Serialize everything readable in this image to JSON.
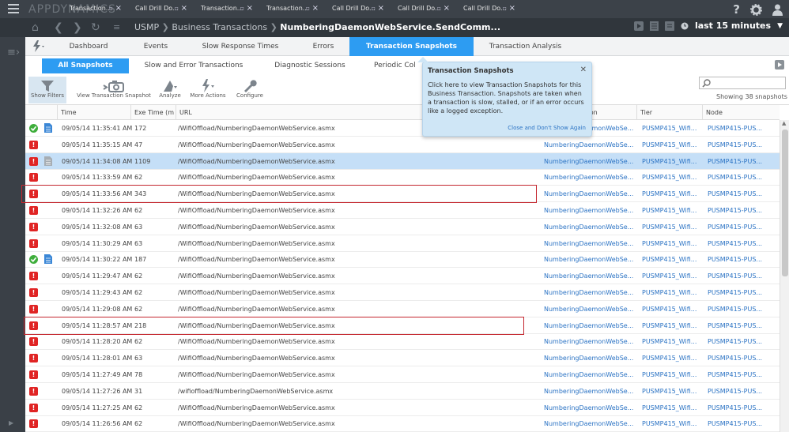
{
  "top_bar": {
    "logo": "APPDYNAMICS",
    "tabs": [
      {
        "label": "Transaction..."
      },
      {
        "label": "Call Drill Do..."
      },
      {
        "label": "Transaction..."
      },
      {
        "label": "Transaction..."
      },
      {
        "label": "Call Drill Do..."
      },
      {
        "label": "Call Drill Do..."
      },
      {
        "label": "Call Drill Do..."
      }
    ],
    "right_icons": [
      "help-icon",
      "gear-icon",
      "user-icon"
    ]
  },
  "nav_bar": {
    "breadcrumb": [
      "USMP",
      "Business Transactions",
      "NumberingDaemonWebService.SendComm..."
    ],
    "time_range": "last 15 minutes"
  },
  "main_tabs": [
    {
      "label": "Dashboard",
      "active": false
    },
    {
      "label": "Events",
      "active": false
    },
    {
      "label": "Slow Response Times",
      "active": false
    },
    {
      "label": "Errors",
      "active": false
    },
    {
      "label": "Transaction Snapshots",
      "active": true
    },
    {
      "label": "Transaction Analysis",
      "active": false
    }
  ],
  "sub_tabs": [
    {
      "label": "All Snapshots",
      "active": true
    },
    {
      "label": "Slow and Error Transactions",
      "active": false
    },
    {
      "label": "Diagnostic Sessions",
      "active": false
    },
    {
      "label": "Periodic Col",
      "active": false
    }
  ],
  "toolbar": {
    "show_filters": "Show Filters",
    "view_snapshot": "View Transaction Snapshot",
    "analyze": "Analyze",
    "more_actions": "More Actions",
    "configure": "Configure",
    "search_placeholder": "",
    "showing": "Showing 38 snapshots"
  },
  "table": {
    "columns": [
      "Time",
      "Exe Time (m",
      "URL",
      "ction",
      "Tier",
      "Node"
    ],
    "rows": [
      {
        "status": "normal",
        "doc": "blue",
        "time": "09/05/14 11:35:41 AM",
        "exe": "172",
        "url": "/WifiOffload/NumberingDaemonWebService.asmx",
        "bt": "NumberingDaemonWebSe...",
        "tier": "PUSMP415_Wifi...",
        "node": "PUSMP415-PUS..."
      },
      {
        "status": "error",
        "doc": "",
        "time": "09/05/14 11:35:15 AM",
        "exe": "47",
        "url": "/WifiOffload/NumberingDaemonWebService.asmx",
        "bt": "NumberingDaemonWebSe...",
        "tier": "PUSMP415_Wifi...",
        "node": "PUSMP415-PUS..."
      },
      {
        "status": "error",
        "doc": "gray",
        "time": "09/05/14 11:34:08 AM",
        "exe": "1109",
        "url": "/WifiOffload/NumberingDaemonWebService.asmx",
        "bt": "NumberingDaemonWebSe...",
        "tier": "PUSMP415_Wifi...",
        "node": "PUSMP415-PUS...",
        "selected": true
      },
      {
        "status": "error",
        "doc": "",
        "time": "09/05/14 11:33:59 AM",
        "exe": "62",
        "url": "/WifiOffload/NumberingDaemonWebService.asmx",
        "bt": "NumberingDaemonWebSe...",
        "tier": "PUSMP415_Wifi...",
        "node": "PUSMP415-PUS..."
      },
      {
        "status": "error",
        "doc": "",
        "time": "09/05/14 11:33:56 AM",
        "exe": "343",
        "url": "/WifiOffload/NumberingDaemonWebService.asmx",
        "bt": "NumberingDaemonWebSe...",
        "tier": "PUSMP415_Wifi...",
        "node": "PUSMP415-PUS...",
        "highlighted": true
      },
      {
        "status": "error",
        "doc": "",
        "time": "09/05/14 11:32:26 AM",
        "exe": "62",
        "url": "/WifiOffload/NumberingDaemonWebService.asmx",
        "bt": "NumberingDaemonWebSe...",
        "tier": "PUSMP415_Wifi...",
        "node": "PUSMP415-PUS..."
      },
      {
        "status": "error",
        "doc": "",
        "time": "09/05/14 11:32:08 AM",
        "exe": "63",
        "url": "/WifiOffload/NumberingDaemonWebService.asmx",
        "bt": "NumberingDaemonWebSe...",
        "tier": "PUSMP415_Wifi...",
        "node": "PUSMP415-PUS..."
      },
      {
        "status": "error",
        "doc": "",
        "time": "09/05/14 11:30:29 AM",
        "exe": "63",
        "url": "/WifiOffload/NumberingDaemonWebService.asmx",
        "bt": "NumberingDaemonWebSe...",
        "tier": "PUSMP415_Wifi...",
        "node": "PUSMP415-PUS..."
      },
      {
        "status": "normal",
        "doc": "blue",
        "time": "09/05/14 11:30:22 AM",
        "exe": "187",
        "url": "/WifiOffload/NumberingDaemonWebService.asmx",
        "bt": "NumberingDaemonWebSe...",
        "tier": "PUSMP415_Wifi...",
        "node": "PUSMP415-PUS..."
      },
      {
        "status": "error",
        "doc": "",
        "time": "09/05/14 11:29:47 AM",
        "exe": "62",
        "url": "/WifiOffload/NumberingDaemonWebService.asmx",
        "bt": "NumberingDaemonWebSe...",
        "tier": "PUSMP415_Wifi...",
        "node": "PUSMP415-PUS..."
      },
      {
        "status": "error",
        "doc": "",
        "time": "09/05/14 11:29:43 AM",
        "exe": "62",
        "url": "/WifiOffload/NumberingDaemonWebService.asmx",
        "bt": "NumberingDaemonWebSe...",
        "tier": "PUSMP415_Wifi...",
        "node": "PUSMP415-PUS..."
      },
      {
        "status": "error",
        "doc": "",
        "time": "09/05/14 11:29:08 AM",
        "exe": "62",
        "url": "/WifiOffload/NumberingDaemonWebService.asmx",
        "bt": "NumberingDaemonWebSe...",
        "tier": "PUSMP415_Wifi...",
        "node": "PUSMP415-PUS..."
      },
      {
        "status": "error",
        "doc": "",
        "time": "09/05/14 11:28:57 AM",
        "exe": "218",
        "url": "/WifiOffload/NumberingDaemonWebService.asmx",
        "bt": "NumberingDaemonWebSe...",
        "tier": "PUSMP415_Wifi...",
        "node": "PUSMP415-PUS...",
        "highlighted": true
      },
      {
        "status": "error",
        "doc": "",
        "time": "09/05/14 11:28:20 AM",
        "exe": "62",
        "url": "/WifiOffload/NumberingDaemonWebService.asmx",
        "bt": "NumberingDaemonWebSe...",
        "tier": "PUSMP415_Wifi...",
        "node": "PUSMP415-PUS..."
      },
      {
        "status": "error",
        "doc": "",
        "time": "09/05/14 11:28:01 AM",
        "exe": "63",
        "url": "/WifiOffload/NumberingDaemonWebService.asmx",
        "bt": "NumberingDaemonWebSe...",
        "tier": "PUSMP415_Wifi...",
        "node": "PUSMP415-PUS..."
      },
      {
        "status": "error",
        "doc": "",
        "time": "09/05/14 11:27:49 AM",
        "exe": "78",
        "url": "/WifiOffload/NumberingDaemonWebService.asmx",
        "bt": "NumberingDaemonWebSe...",
        "tier": "PUSMP415_Wifi...",
        "node": "PUSMP415-PUS..."
      },
      {
        "status": "error",
        "doc": "",
        "time": "09/05/14 11:27:26 AM",
        "exe": "31",
        "url": "/wifioffload/NumberingDaemonWebService.asmx",
        "bt": "NumberingDaemonWebSe...",
        "tier": "PUSMP415_Wifi...",
        "node": "PUSMP415-PUS..."
      },
      {
        "status": "error",
        "doc": "",
        "time": "09/05/14 11:27:25 AM",
        "exe": "62",
        "url": "/WifiOffload/NumberingDaemonWebService.asmx",
        "bt": "NumberingDaemonWebSe...",
        "tier": "PUSMP415_Wifi...",
        "node": "PUSMP415-PUS..."
      },
      {
        "status": "error",
        "doc": "",
        "time": "09/05/14 11:26:56 AM",
        "exe": "62",
        "url": "/WifiOffload/NumberingDaemonWebService.asmx",
        "bt": "NumberingDaemonWebSe...",
        "tier": "PUSMP415_Wifi...",
        "node": "PUSMP415-PUS..."
      }
    ]
  },
  "tooltip": {
    "title": "Transaction Snapshots",
    "body": "Click here to view Transaction Snapshots for this Business Transaction. Snapshots are taken when a transaction is slow, stalled, or if an error occurs like a logged exception.",
    "close_link": "Close and Don't Show Again"
  },
  "colors": {
    "accent": "#2d9cf2",
    "error": "#e02424",
    "ok": "#3fae3c",
    "link": "#2b73c4",
    "highlight_box": "#c4262e"
  }
}
